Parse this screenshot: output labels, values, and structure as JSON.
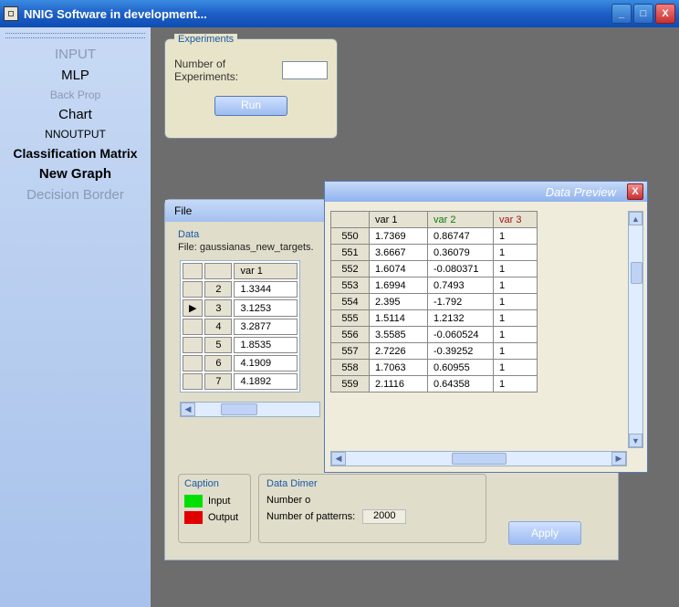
{
  "window": {
    "title": "NNIG Software in development..."
  },
  "sidebar": {
    "input": "INPUT",
    "mlp": "MLP",
    "backprop": "Back Prop",
    "chart": "Chart",
    "nnoutput": "NNOUTPUT",
    "classmatrix": "Classification Matrix",
    "newgraph": "New Graph",
    "decision": "Decision Border"
  },
  "experiments": {
    "group": "Experiments",
    "label": "Number of Experiments:",
    "value": "",
    "run": "Run"
  },
  "filepanel": {
    "tab": "File",
    "group": "Data",
    "file_label": "File:",
    "file_name": "gaussianas_new_targets.",
    "header_var1": "var 1",
    "rows": [
      {
        "mark": "",
        "idx": "2",
        "v": "1.3344"
      },
      {
        "mark": "▶",
        "idx": "3",
        "v": "3.1253"
      },
      {
        "mark": "",
        "idx": "4",
        "v": "3.2877"
      },
      {
        "mark": "",
        "idx": "5",
        "v": "1.8535"
      },
      {
        "mark": "",
        "idx": "6",
        "v": "4.1909"
      },
      {
        "mark": "",
        "idx": "7",
        "v": "4.1892"
      }
    ],
    "caption": {
      "title": "Caption",
      "input": "Input",
      "output": "Output"
    },
    "dimer": {
      "title": "Data Dimer",
      "n_label": "Number o",
      "patterns_label": "Number of patterns:",
      "patterns_value": "2000"
    },
    "apply": "Apply"
  },
  "preview": {
    "title": "Data Preview",
    "headers": {
      "var1": "var 1",
      "var2": "var 2",
      "var3": "var 3"
    },
    "rows": [
      {
        "idx": "550",
        "v1": "1.7369",
        "v2": "0.86747",
        "v3": "1"
      },
      {
        "idx": "551",
        "v1": "3.6667",
        "v2": "0.36079",
        "v3": "1"
      },
      {
        "idx": "552",
        "v1": "1.6074",
        "v2": "-0.080371",
        "v3": "1"
      },
      {
        "idx": "553",
        "v1": "1.6994",
        "v2": "0.7493",
        "v3": "1"
      },
      {
        "idx": "554",
        "v1": "2.395",
        "v2": "-1.792",
        "v3": "1"
      },
      {
        "idx": "555",
        "v1": "1.5114",
        "v2": "1.2132",
        "v3": "1"
      },
      {
        "idx": "556",
        "v1": "3.5585",
        "v2": "-0.060524",
        "v3": "1"
      },
      {
        "idx": "557",
        "v1": "2.7226",
        "v2": "-0.39252",
        "v3": "1"
      },
      {
        "idx": "558",
        "v1": "1.7063",
        "v2": "0.60955",
        "v3": "1"
      },
      {
        "idx": "559",
        "v1": "2.1116",
        "v2": "0.64358",
        "v3": "1"
      }
    ]
  }
}
